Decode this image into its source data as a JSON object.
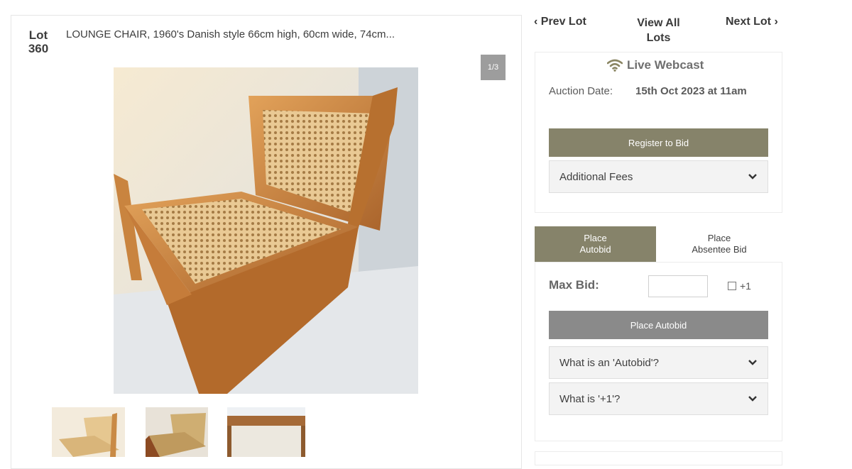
{
  "lot": {
    "label": "Lot",
    "number": "360",
    "title": "LOUNGE CHAIR, 1960's Danish style 66cm high, 60cm wide, 74cm...",
    "image_counter": "1/3"
  },
  "nav": {
    "prev": "Prev Lot",
    "view_all_line1": "View All",
    "view_all_line2": "Lots",
    "next": "Next Lot"
  },
  "auction": {
    "webcast": "Live Webcast",
    "date_label": "Auction Date:",
    "date_value": "15th Oct 2023 at 11am",
    "register": "Register to Bid",
    "fees": "Additional Fees"
  },
  "bid_tabs": {
    "autobid_line1": "Place",
    "autobid_line2": "Autobid",
    "absentee_line1": "Place",
    "absentee_line2": "Absentee Bid"
  },
  "bid_form": {
    "max_bid_label": "Max Bid:",
    "max_bid_value": "",
    "plus_one": "+1",
    "place_autobid": "Place Autobid",
    "faq_autobid": "What is an 'Autobid'?",
    "faq_plus_one": "What is '+1'?"
  },
  "colors": {
    "accent_olive": "#86836a",
    "button_grey": "#8a8a8a"
  },
  "icons": [
    "wifi-icon",
    "chevron-left-icon",
    "chevron-right-icon",
    "chevron-down-icon"
  ]
}
